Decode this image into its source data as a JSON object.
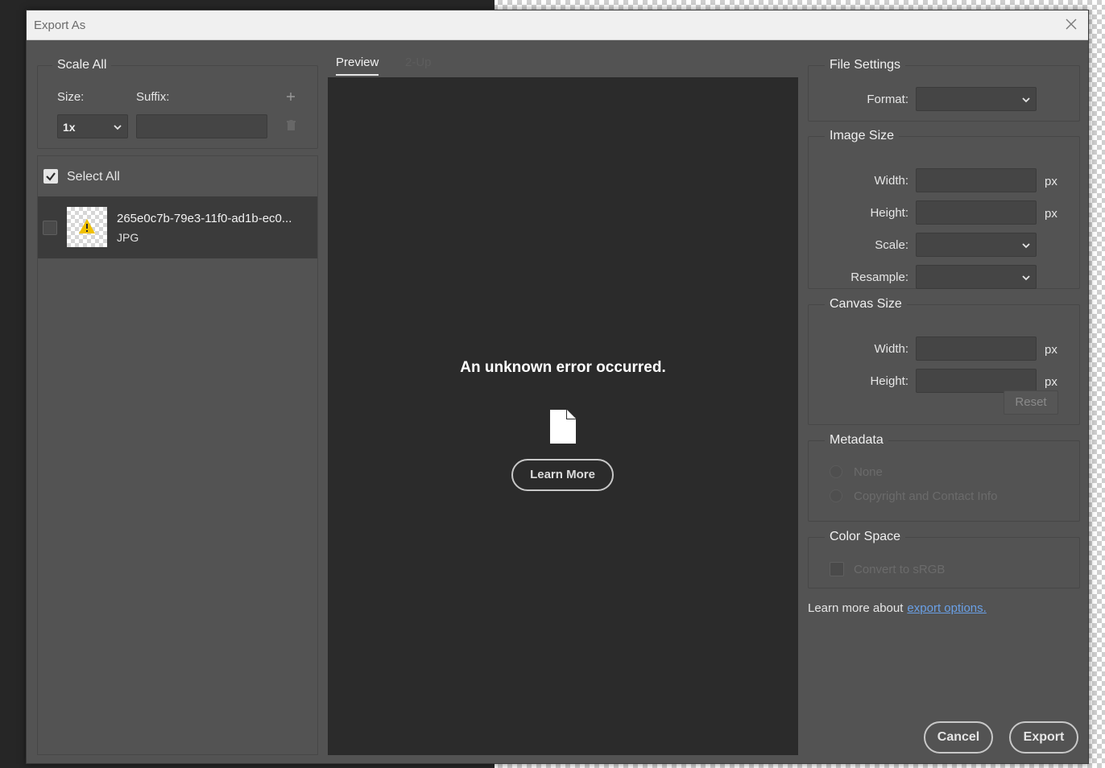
{
  "dialog": {
    "title": "Export As"
  },
  "scale_all": {
    "legend": "Scale All",
    "size_label": "Size:",
    "suffix_label": "Suffix:",
    "size_value": "1x",
    "suffix_value": ""
  },
  "file_list": {
    "select_all_label": "Select All",
    "select_all_checked": true,
    "items": [
      {
        "name": "265e0c7b-79e3-11f0-ad1b-ec0...",
        "type": "JPG",
        "checked": false
      }
    ]
  },
  "tabs": [
    {
      "label": "Preview",
      "active": true
    },
    {
      "label": "2-Up",
      "active": false
    }
  ],
  "preview": {
    "error_message": "An unknown error occurred.",
    "learn_more_button": "Learn More"
  },
  "file_settings": {
    "legend": "File Settings",
    "format_label": "Format:",
    "format_value": ""
  },
  "image_size": {
    "legend": "Image Size",
    "width_label": "Width:",
    "height_label": "Height:",
    "scale_label": "Scale:",
    "resample_label": "Resample:",
    "unit": "px"
  },
  "canvas_size": {
    "legend": "Canvas Size",
    "width_label": "Width:",
    "height_label": "Height:",
    "unit": "px",
    "reset_button": "Reset"
  },
  "metadata": {
    "legend": "Metadata",
    "options": [
      "None",
      "Copyright and Contact Info"
    ]
  },
  "color_space": {
    "legend": "Color Space",
    "convert_label": "Convert to sRGB"
  },
  "learn_more": {
    "text": "Learn more about",
    "link": "export options."
  },
  "footer": {
    "cancel": "Cancel",
    "export": "Export"
  },
  "colors": {
    "dialog_bg": "#535353",
    "preview_bg": "#2b2b2b",
    "link": "#6aa0e6",
    "warning": "#f0c000"
  }
}
